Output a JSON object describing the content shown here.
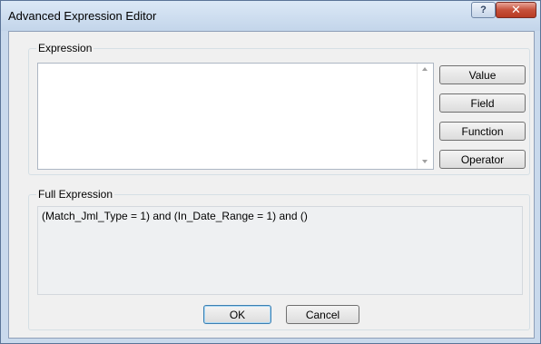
{
  "window": {
    "title": "Advanced Expression Editor",
    "help_icon": "question-mark-icon",
    "help_glyph": "?",
    "close_icon": "close-x-icon",
    "close_glyph": "✕"
  },
  "expression_group": {
    "caption": "Expression",
    "value": "",
    "buttons": {
      "value": "Value",
      "field": "Field",
      "function": "Function",
      "operator": "Operator"
    }
  },
  "full_expression_group": {
    "caption": "Full Expression",
    "text": "(Match_Jml_Type = 1) and (In_Date_Range = 1) and ()"
  },
  "footer": {
    "ok": "OK",
    "cancel": "Cancel"
  },
  "colors": {
    "window_frame": "#c9d9ec",
    "close_button": "#c6503a",
    "dialog_background": "#f0f0f0"
  }
}
